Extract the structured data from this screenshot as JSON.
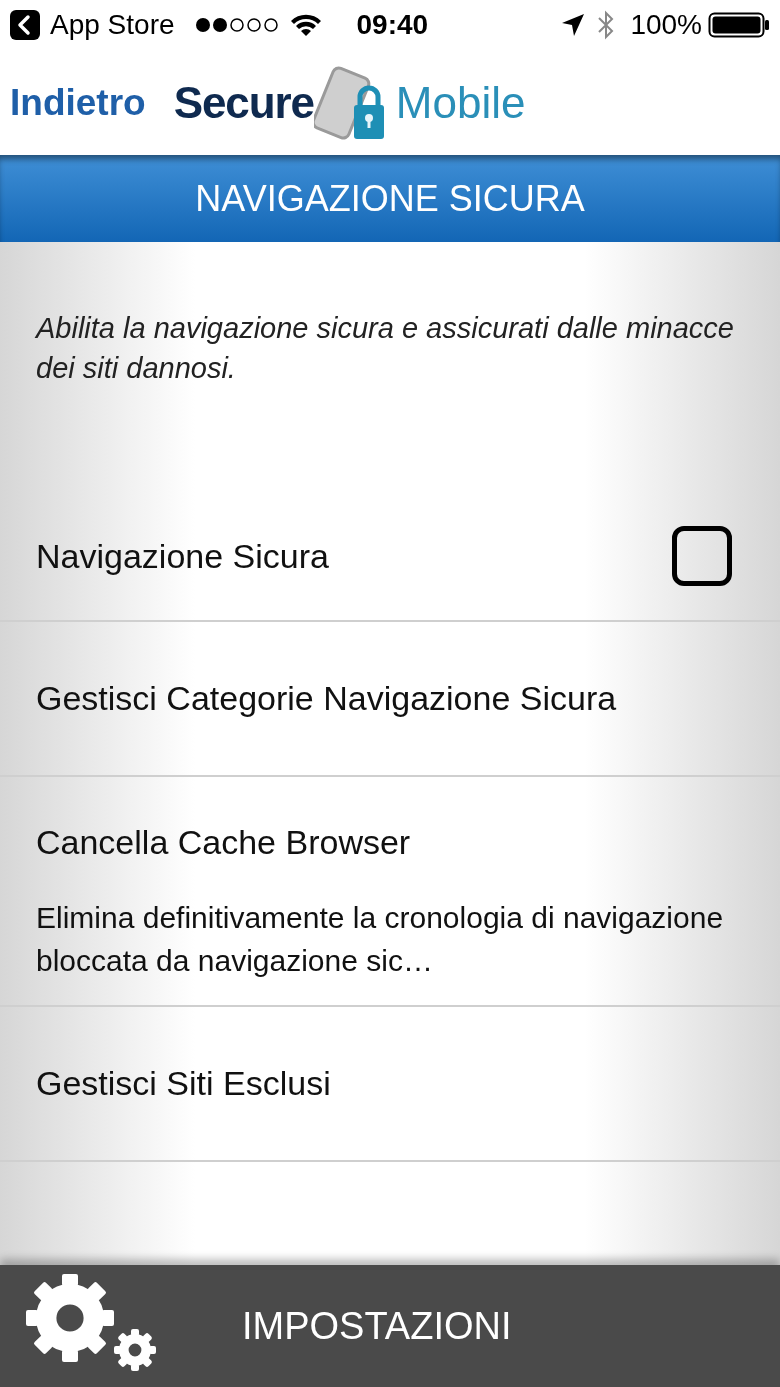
{
  "status_bar": {
    "back_app": "App Store",
    "time": "09:40",
    "battery": "100%"
  },
  "header": {
    "back": "Indietro",
    "logo_word_1": "Secure",
    "logo_word_2": "Mobile"
  },
  "title": "NAVIGAZIONE SICURA",
  "description": "Abilita la navigazione sicura e assicurati dalle minacce dei siti dannosi.",
  "rows": [
    {
      "kind": "toggle",
      "label": "Navigazione Sicura",
      "checked": false
    },
    {
      "kind": "link",
      "label": "Gestisci Categorie Navigazione Sicura"
    },
    {
      "kind": "detail",
      "label": "Cancella Cache Browser",
      "subtitle": "Elimina definitivamente la cronologia di navigazione bloccata da navigazione sic…"
    },
    {
      "kind": "link",
      "label": "Gestisci Siti Esclusi"
    }
  ],
  "bottom_bar": {
    "label": "IMPOSTAZIONI"
  }
}
